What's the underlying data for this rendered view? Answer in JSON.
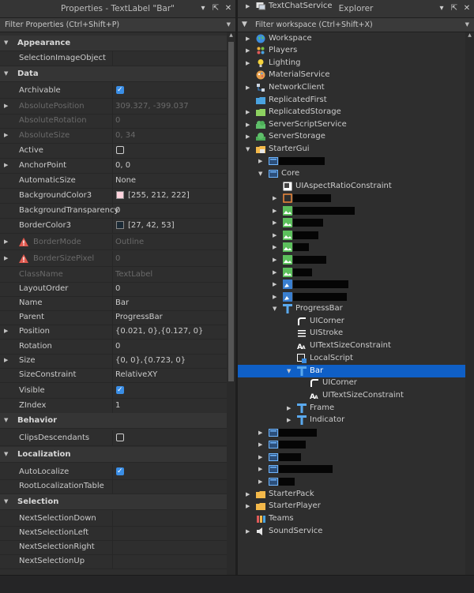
{
  "colors": {
    "selection": "#0f5fc6",
    "checkbox": "#3a8ee6",
    "bg": "#2e2e2e"
  },
  "properties": {
    "title": "Properties - TextLabel \"Bar\"",
    "filter_placeholder": "Filter Properties (Ctrl+Shift+P)",
    "rows": [
      {
        "type": "section",
        "name": "Appearance"
      },
      {
        "type": "prop",
        "name": "SelectionImageObject",
        "value": ""
      },
      {
        "type": "section",
        "name": "Data"
      },
      {
        "type": "prop",
        "name": "Archivable",
        "checkbox": true
      },
      {
        "type": "prop",
        "name": "AbsolutePosition",
        "value": "309.327, -399.037",
        "disabled": true,
        "expand": true
      },
      {
        "type": "prop",
        "name": "AbsoluteRotation",
        "value": "0",
        "disabled": true
      },
      {
        "type": "prop",
        "name": "AbsoluteSize",
        "value": "0, 34",
        "disabled": true,
        "expand": true
      },
      {
        "type": "prop",
        "name": "Active",
        "checkbox": false
      },
      {
        "type": "prop",
        "name": "AnchorPoint",
        "value": "0, 0",
        "expand": true
      },
      {
        "type": "prop",
        "name": "AutomaticSize",
        "value": "None"
      },
      {
        "type": "prop",
        "name": "BackgroundColor3",
        "value": "[255, 212, 222]",
        "swatch": "#ffd4de"
      },
      {
        "type": "prop",
        "name": "BackgroundTransparency",
        "value": "0"
      },
      {
        "type": "prop",
        "name": "BorderColor3",
        "value": "[27, 42, 53]",
        "swatch": "#1b2a35"
      },
      {
        "type": "prop",
        "name": "BorderMode",
        "value": "Outline",
        "disabled": true,
        "expand": true,
        "warning": true
      },
      {
        "type": "prop",
        "name": "BorderSizePixel",
        "value": "0",
        "disabled": true,
        "expand": true,
        "warning": true
      },
      {
        "type": "prop",
        "name": "ClassName",
        "value": "TextLabel",
        "disabled": true
      },
      {
        "type": "prop",
        "name": "LayoutOrder",
        "value": "0"
      },
      {
        "type": "prop",
        "name": "Name",
        "value": "Bar"
      },
      {
        "type": "prop",
        "name": "Parent",
        "value": "ProgressBar"
      },
      {
        "type": "prop",
        "name": "Position",
        "value": "{0.021, 0},{0.127, 0}",
        "expand": true
      },
      {
        "type": "prop",
        "name": "Rotation",
        "value": "0"
      },
      {
        "type": "prop",
        "name": "Size",
        "value": "{0, 0},{0.723, 0}",
        "expand": true
      },
      {
        "type": "prop",
        "name": "SizeConstraint",
        "value": "RelativeXY"
      },
      {
        "type": "prop",
        "name": "Visible",
        "checkbox": true
      },
      {
        "type": "prop",
        "name": "ZIndex",
        "value": "1"
      },
      {
        "type": "section",
        "name": "Behavior"
      },
      {
        "type": "prop",
        "name": "ClipsDescendants",
        "checkbox": false
      },
      {
        "type": "section",
        "name": "Localization"
      },
      {
        "type": "prop",
        "name": "AutoLocalize",
        "checkbox": true
      },
      {
        "type": "prop",
        "name": "RootLocalizationTable",
        "value": ""
      },
      {
        "type": "section",
        "name": "Selection"
      },
      {
        "type": "prop",
        "name": "NextSelectionDown",
        "value": ""
      },
      {
        "type": "prop",
        "name": "NextSelectionLeft",
        "value": ""
      },
      {
        "type": "prop",
        "name": "NextSelectionRight",
        "value": ""
      },
      {
        "type": "prop",
        "name": "NextSelectionUp",
        "value": ""
      }
    ]
  },
  "explorer": {
    "title": "Explorer",
    "filter_placeholder": "Filter workspace (Ctrl+Shift+X)",
    "items": [
      {
        "label": "Workspace",
        "depth": 0,
        "caret": "closed",
        "icon": "globe-icon"
      },
      {
        "label": "Players",
        "depth": 0,
        "caret": "closed",
        "icon": "players-icon"
      },
      {
        "label": "Lighting",
        "depth": 0,
        "caret": "closed",
        "icon": "lightbulb-icon"
      },
      {
        "label": "MaterialService",
        "depth": 0,
        "caret": "none",
        "icon": "material-icon"
      },
      {
        "label": "NetworkClient",
        "depth": 0,
        "caret": "closed",
        "icon": "network-icon"
      },
      {
        "label": "ReplicatedFirst",
        "depth": 0,
        "caret": "none",
        "icon": "folder-blue-icon"
      },
      {
        "label": "ReplicatedStorage",
        "depth": 0,
        "caret": "closed",
        "icon": "folder-green-icon"
      },
      {
        "label": "ServerScriptService",
        "depth": 0,
        "caret": "closed",
        "icon": "server-script-icon"
      },
      {
        "label": "ServerStorage",
        "depth": 0,
        "caret": "closed",
        "icon": "server-storage-icon"
      },
      {
        "label": "StarterGui",
        "depth": 0,
        "caret": "open",
        "icon": "startergui-icon"
      },
      {
        "label": "",
        "depth": 1,
        "caret": "closed",
        "icon": "screengui-icon",
        "redact": 58
      },
      {
        "label": "Core",
        "depth": 1,
        "caret": "open",
        "icon": "screengui-icon"
      },
      {
        "label": "UIAspectRatioConstraint",
        "depth": 2,
        "caret": "none",
        "icon": "aspect-ratio-icon"
      },
      {
        "label": "",
        "depth": 2,
        "caret": "closed",
        "icon": "frame-icon",
        "redact": 48
      },
      {
        "label": "",
        "depth": 2,
        "caret": "closed",
        "icon": "imagelabel-icon",
        "redact": 78
      },
      {
        "label": "",
        "depth": 2,
        "caret": "closed",
        "icon": "imagelabel-icon",
        "redact": 38
      },
      {
        "label": "",
        "depth": 2,
        "caret": "closed",
        "icon": "imagelabel-icon",
        "redact": 32
      },
      {
        "label": "",
        "depth": 2,
        "caret": "closed",
        "icon": "imagelabel-icon",
        "redact": 20
      },
      {
        "label": "",
        "depth": 2,
        "caret": "closed",
        "icon": "imagelabel-icon",
        "redact": 42
      },
      {
        "label": "",
        "depth": 2,
        "caret": "closed",
        "icon": "imagelabel-icon",
        "redact": 24
      },
      {
        "label": "",
        "depth": 2,
        "caret": "closed",
        "icon": "imagebutton-icon",
        "redact": 70
      },
      {
        "label": "",
        "depth": 2,
        "caret": "closed",
        "icon": "imagebutton-icon",
        "redact": 68
      },
      {
        "label": "ProgressBar",
        "depth": 2,
        "caret": "open",
        "icon": "textlabel-icon"
      },
      {
        "label": "UICorner",
        "depth": 3,
        "caret": "none",
        "icon": "uicorner-icon"
      },
      {
        "label": "UIStroke",
        "depth": 3,
        "caret": "none",
        "icon": "uistroke-icon"
      },
      {
        "label": "UITextSizeConstraint",
        "depth": 3,
        "caret": "none",
        "icon": "textsize-icon"
      },
      {
        "label": "LocalScript",
        "depth": 3,
        "caret": "none",
        "icon": "localscript-icon"
      },
      {
        "label": "Bar",
        "depth": 3,
        "caret": "open",
        "icon": "textlabel-icon",
        "selected": true
      },
      {
        "label": "UICorner",
        "depth": 4,
        "caret": "none",
        "icon": "uicorner-icon"
      },
      {
        "label": "UITextSizeConstraint",
        "depth": 4,
        "caret": "none",
        "icon": "textsize-icon"
      },
      {
        "label": "Frame",
        "depth": 3,
        "caret": "closed",
        "icon": "textlabel-icon"
      },
      {
        "label": "Indicator",
        "depth": 3,
        "caret": "closed",
        "icon": "textlabel-icon"
      },
      {
        "label": "",
        "depth": 1,
        "caret": "closed",
        "icon": "screengui-icon",
        "redact": 48
      },
      {
        "label": "",
        "depth": 1,
        "caret": "closed",
        "icon": "screengui-icon",
        "redact": 34
      },
      {
        "label": "",
        "depth": 1,
        "caret": "closed",
        "icon": "screengui-icon",
        "redact": 28
      },
      {
        "label": "",
        "depth": 1,
        "caret": "closed",
        "icon": "screengui-icon",
        "redact": 68
      },
      {
        "label": "",
        "depth": 1,
        "caret": "closed",
        "icon": "screengui-icon",
        "redact": 20
      },
      {
        "label": "StarterPack",
        "depth": 0,
        "caret": "closed",
        "icon": "folder-orange-icon"
      },
      {
        "label": "StarterPlayer",
        "depth": 0,
        "caret": "closed",
        "icon": "folder-orange-icon"
      },
      {
        "label": "Teams",
        "depth": 0,
        "caret": "none",
        "icon": "teams-icon"
      },
      {
        "label": "SoundService",
        "depth": 0,
        "caret": "closed",
        "icon": "sound-icon"
      },
      {
        "label": "TextChatService",
        "depth": 0,
        "caret": "closed",
        "icon": "textchat-icon"
      }
    ]
  }
}
